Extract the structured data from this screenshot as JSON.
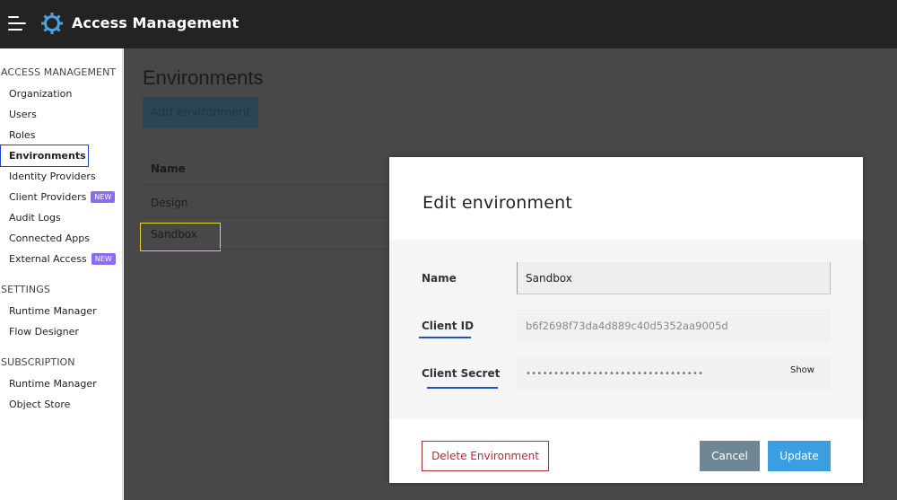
{
  "header": {
    "app_title": "Access Management",
    "menu_icon": "hamburger-menu-icon",
    "logo_icon": "gear-logo-icon",
    "logo_color": "#4aa3df"
  },
  "sidebar": {
    "sections": [
      {
        "title": "ACCESS MANAGEMENT",
        "items": [
          {
            "label": "Organization"
          },
          {
            "label": "Users"
          },
          {
            "label": "Roles"
          },
          {
            "label": "Environments",
            "active": true
          },
          {
            "label": "Identity Providers"
          },
          {
            "label": "Client Providers",
            "badge": "NEW"
          },
          {
            "label": "Audit Logs"
          },
          {
            "label": "Connected Apps"
          },
          {
            "label": "External Access",
            "badge": "NEW"
          }
        ]
      },
      {
        "title": "SETTINGS",
        "items": [
          {
            "label": "Runtime Manager"
          },
          {
            "label": "Flow Designer"
          }
        ]
      },
      {
        "title": "SUBSCRIPTION",
        "items": [
          {
            "label": "Runtime Manager"
          },
          {
            "label": "Object Store"
          }
        ]
      }
    ],
    "badge_color": "#8a6cf0",
    "active_outline_color": "#1f3fd1"
  },
  "main": {
    "page_title": "Environments",
    "add_button": "Add environment",
    "table": {
      "column_name": "Name",
      "rows": [
        {
          "name": "Design"
        },
        {
          "name": "Sandbox"
        }
      ]
    },
    "highlight_color": "#e8d82c"
  },
  "modal": {
    "title": "Edit environment",
    "fields": {
      "name_label": "Name",
      "name_value": "Sandbox",
      "client_id_label": "Client ID",
      "client_id_value": "b6f2698f73da4d889c40d5352aa9005d",
      "client_secret_label": "Client Secret",
      "client_secret_value": "••••••••••••••••••••••••••••••••",
      "show_label": "Show"
    },
    "buttons": {
      "delete": "Delete Environment",
      "cancel": "Cancel",
      "update": "Update"
    },
    "colors": {
      "delete": "#b52a3a",
      "cancel": "#6f8795",
      "update": "#3a9ee0",
      "label_underline": "#1f54c8"
    }
  }
}
